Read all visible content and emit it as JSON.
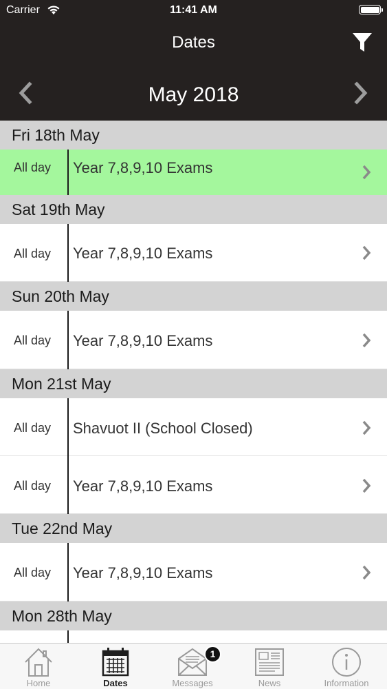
{
  "status_bar": {
    "carrier": "Carrier",
    "time": "11:41 AM"
  },
  "nav": {
    "title": "Dates"
  },
  "month": {
    "label": "May 2018"
  },
  "sections": [
    {
      "header": "Fri 18th May",
      "events": [
        {
          "time": "All day",
          "title": "Year 7,8,9,10 Exams",
          "highlighted": true
        }
      ]
    },
    {
      "header": "Sat 19th May",
      "events": [
        {
          "time": "All day",
          "title": "Year 7,8,9,10 Exams"
        }
      ]
    },
    {
      "header": "Sun 20th May",
      "events": [
        {
          "time": "All day",
          "title": "Year 7,8,9,10 Exams"
        }
      ]
    },
    {
      "header": "Mon 21st May",
      "events": [
        {
          "time": "All day",
          "title": "Shavuot II (School Closed)"
        },
        {
          "time": "All day",
          "title": "Year 7,8,9,10 Exams"
        }
      ]
    },
    {
      "header": "Tue 22nd May",
      "events": [
        {
          "time": "All day",
          "title": "Year 7,8,9,10 Exams"
        }
      ]
    },
    {
      "header": "Mon 28th May",
      "events": []
    }
  ],
  "tabs": [
    {
      "label": "Home",
      "icon": "home-icon"
    },
    {
      "label": "Dates",
      "icon": "calendar-icon",
      "active": true
    },
    {
      "label": "Messages",
      "icon": "envelope-icon"
    },
    {
      "label": "News",
      "icon": "newspaper-icon"
    },
    {
      "label": "Information",
      "icon": "info-icon"
    }
  ],
  "badges": {
    "messages": "1"
  },
  "colors": {
    "header_bg": "#252120",
    "highlight": "#a4f79d",
    "section_bg": "#d3d3d3"
  }
}
